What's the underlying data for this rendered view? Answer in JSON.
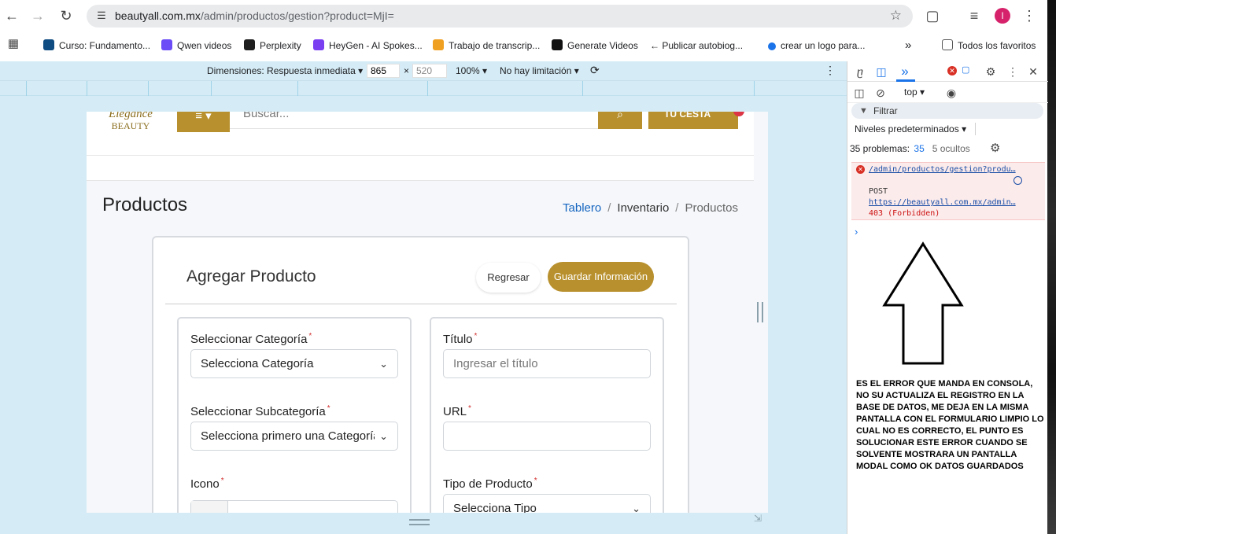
{
  "browser": {
    "url_host": "beautyall.com.mx",
    "url_path": "/admin/productos/gestion?product=MjI="
  },
  "bookmarks": [
    {
      "label": "Curso: Fundamento...",
      "color": "#0f4c81"
    },
    {
      "label": "Qwen videos",
      "color": "#6b4cf6"
    },
    {
      "label": "Perplexity",
      "color": "#1f1f1f"
    },
    {
      "label": "HeyGen - AI Spokes...",
      "color": "#7b3ff2"
    },
    {
      "label": "Trabajo de transcrip...",
      "color": "#f0a020"
    },
    {
      "label": "Generate Videos",
      "color": "#111111"
    },
    {
      "label": "← Publicar autobiog...",
      "color": "#333333"
    },
    {
      "label": "crear un logo para...",
      "color": "#1a73e8"
    }
  ],
  "bookmarks_more": "»",
  "bookmarks_all": "Todos los favoritos",
  "device": {
    "dimensions_label": "Dimensiones: Respuesta inmediata ▾",
    "width": "865",
    "times": "×",
    "height": "520",
    "zoom": "100% ▾",
    "throttle": "No hay limitación ▾"
  },
  "site": {
    "logo_top": "Elegance",
    "logo_bottom": "BEAUTY",
    "menu_glyph": "≡ ▾",
    "search_placeholder": "Buscar...",
    "search_glyph": "⌕",
    "cart_label": "TU CESTA",
    "page_title": "Productos",
    "breadcrumb": {
      "home": "Tablero",
      "mid": "Inventario",
      "current": "Productos",
      "sep": "/"
    }
  },
  "form": {
    "title": "Agregar Producto",
    "back_label": "Regresar",
    "save_label": "Guardar Información",
    "required_mark": "*",
    "category_label": "Seleccionar Categoría",
    "category_value": "Selecciona Categoría",
    "subcategory_label": "Seleccionar Subcategoría",
    "subcategory_value": "Selecciona primero una Categoría",
    "icon_label": "Icono",
    "icon_addon": "⌕",
    "title_label": "Título",
    "title_placeholder": "Ingresar el título",
    "url_label": "URL",
    "type_label": "Tipo de Producto",
    "type_value": "Selecciona Tipo",
    "chevron": "⌵"
  },
  "devtools": {
    "context": "top ▾",
    "filter_placeholder": "Filtrar",
    "levels": "Niveles predeterminados ▾",
    "issues_label": "35 problemas:",
    "issues_count": "35",
    "hidden_label": "5 ocultos",
    "error": {
      "link": "/admin/productos/gestion?produ…",
      "method": "POST",
      "url": "https://beautyall.com.mx/admin…",
      "status": "403 (Forbidden)"
    },
    "prompt": "›"
  },
  "annotation": "ES EL ERROR QUE MANDA EN CONSOLA, NO SU ACTUALIZA EL REGISTRO EN LA BASE DE DATOS, ME DEJA EN LA MISMA PANTALLA CON EL FORMULARIO LIMPIO LO CUAL NO ES CORRECTO, EL PUNTO ES SOLUCIONAR ESTE ERROR CUANDO SE SOLVENTE MOSTRARA UN PANTALLA MODAL COMO OK DATOS GUARDADOS",
  "colors": {
    "brand": "#b8902d",
    "error": "#d93025",
    "link": "#1565c0"
  }
}
